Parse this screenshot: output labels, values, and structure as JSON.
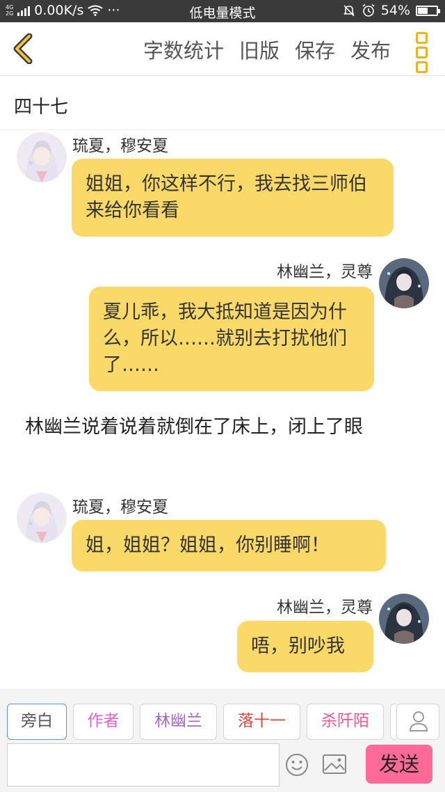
{
  "status_bar": {
    "net_top": "4G",
    "net_bottom": "2G",
    "speed": "0.00K/s",
    "dots": "···",
    "mode": "低电量模式",
    "battery": "54%",
    "battery_level": 0.54
  },
  "toolbar": {
    "word_count": "字数统计",
    "old_version": "旧版",
    "save": "保存",
    "publish": "发布"
  },
  "chapter": {
    "title": "四十七"
  },
  "messages": [
    {
      "speaker": "琉夏，穆安夏",
      "text": "姐姐，你这样不行，我去找三师伯来给你看看"
    },
    {
      "speaker": "林幽兰，灵尊",
      "text": "夏儿乖，我大抵知道是因为什么，所以……就别去打扰他们了……"
    },
    {
      "narration": "林幽兰说着说着就倒在了床上，闭上了眼"
    },
    {
      "speaker": "琉夏，穆安夏",
      "text": "姐，姐姐？姐姐，你别睡啊！"
    },
    {
      "speaker": "林幽兰，灵尊",
      "text": "唔，别吵我"
    }
  ],
  "roles": [
    {
      "label": "旁白",
      "color": "#555555"
    },
    {
      "label": "作者",
      "color": "#e660c9"
    },
    {
      "label": "林幽兰",
      "color": "#9c6bc9"
    },
    {
      "label": "落十一",
      "color": "#e0443b"
    },
    {
      "label": "杀阡陌",
      "color": "#f0588f"
    }
  ],
  "input": {
    "value": "",
    "send": "发送"
  },
  "colors": {
    "bubble": "#fbd968",
    "accent": "#e5b52a",
    "send": "#ff6a9a"
  },
  "icons": [
    "back-chevron-icon",
    "more-menu-icon",
    "emoji-icon",
    "image-icon",
    "user-icon",
    "wifi-icon",
    "signal-icon",
    "battery-icon",
    "mute-bell-icon",
    "alarm-icon"
  ]
}
